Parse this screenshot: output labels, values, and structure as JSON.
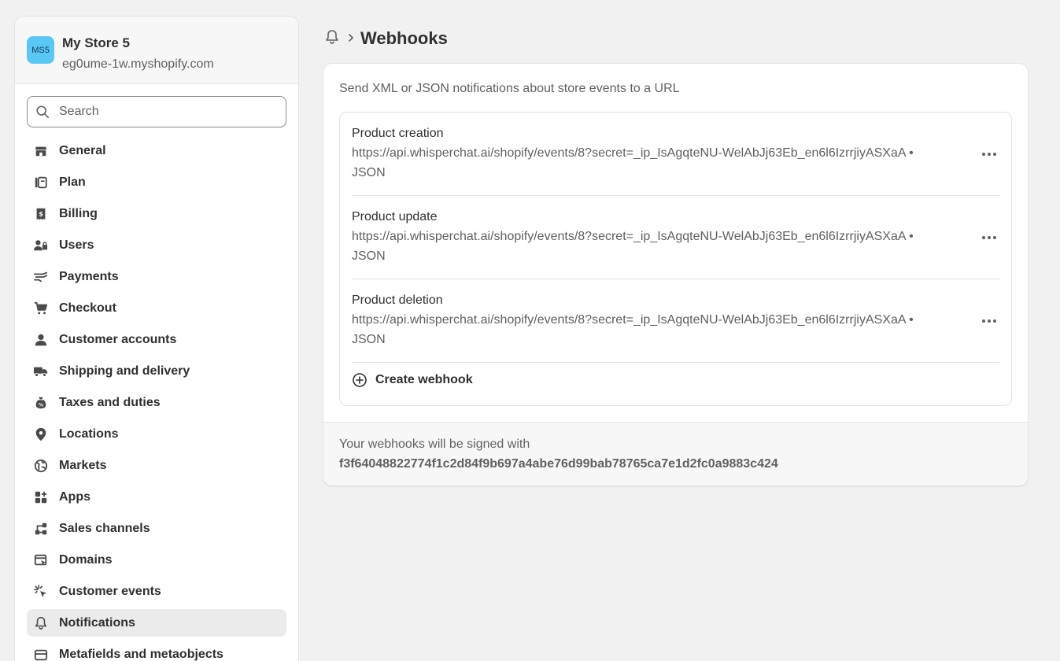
{
  "store": {
    "avatar_initials": "MS5",
    "avatar_color": "#5bc7f5",
    "name": "My Store 5",
    "domain": "eg0ume-1w.myshopify.com"
  },
  "search": {
    "placeholder": "Search"
  },
  "sidebar": {
    "items": [
      {
        "label": "General",
        "icon": "store-icon"
      },
      {
        "label": "Plan",
        "icon": "plan-icon"
      },
      {
        "label": "Billing",
        "icon": "billing-icon"
      },
      {
        "label": "Users",
        "icon": "users-icon"
      },
      {
        "label": "Payments",
        "icon": "payments-icon"
      },
      {
        "label": "Checkout",
        "icon": "cart-icon"
      },
      {
        "label": "Customer accounts",
        "icon": "person-icon"
      },
      {
        "label": "Shipping and delivery",
        "icon": "truck-icon"
      },
      {
        "label": "Taxes and duties",
        "icon": "tax-icon"
      },
      {
        "label": "Locations",
        "icon": "location-icon"
      },
      {
        "label": "Markets",
        "icon": "globe-icon"
      },
      {
        "label": "Apps",
        "icon": "apps-icon"
      },
      {
        "label": "Sales channels",
        "icon": "channels-icon"
      },
      {
        "label": "Domains",
        "icon": "domains-icon"
      },
      {
        "label": "Customer events",
        "icon": "cursor-click-icon"
      },
      {
        "label": "Notifications",
        "icon": "bell-icon",
        "active": true
      },
      {
        "label": "Metafields and metaobjects",
        "icon": "metafields-icon"
      }
    ]
  },
  "header": {
    "title": "Webhooks"
  },
  "webhooks": {
    "description": "Send XML or JSON notifications about store events to a URL",
    "items": [
      {
        "title": "Product creation",
        "url": "https://api.whisperchat.ai/shopify/events/8?secret=_ip_IsAgqteNU-WelAbJj63Eb_en6l6IzrrjiyASXaA •",
        "format": "JSON"
      },
      {
        "title": "Product update",
        "url": "https://api.whisperchat.ai/shopify/events/8?secret=_ip_IsAgqteNU-WelAbJj63Eb_en6l6IzrrjiyASXaA •",
        "format": "JSON"
      },
      {
        "title": "Product deletion",
        "url": "https://api.whisperchat.ai/shopify/events/8?secret=_ip_IsAgqteNU-WelAbJj63Eb_en6l6IzrrjiyASXaA •",
        "format": "JSON"
      }
    ],
    "create_label": "Create webhook",
    "signature_label": "Your webhooks will be signed with",
    "signature_key": "f3f64048822774f1c2d84f9b697a4abe76d99bab78765ca7e1d2fc0a9883c424"
  }
}
